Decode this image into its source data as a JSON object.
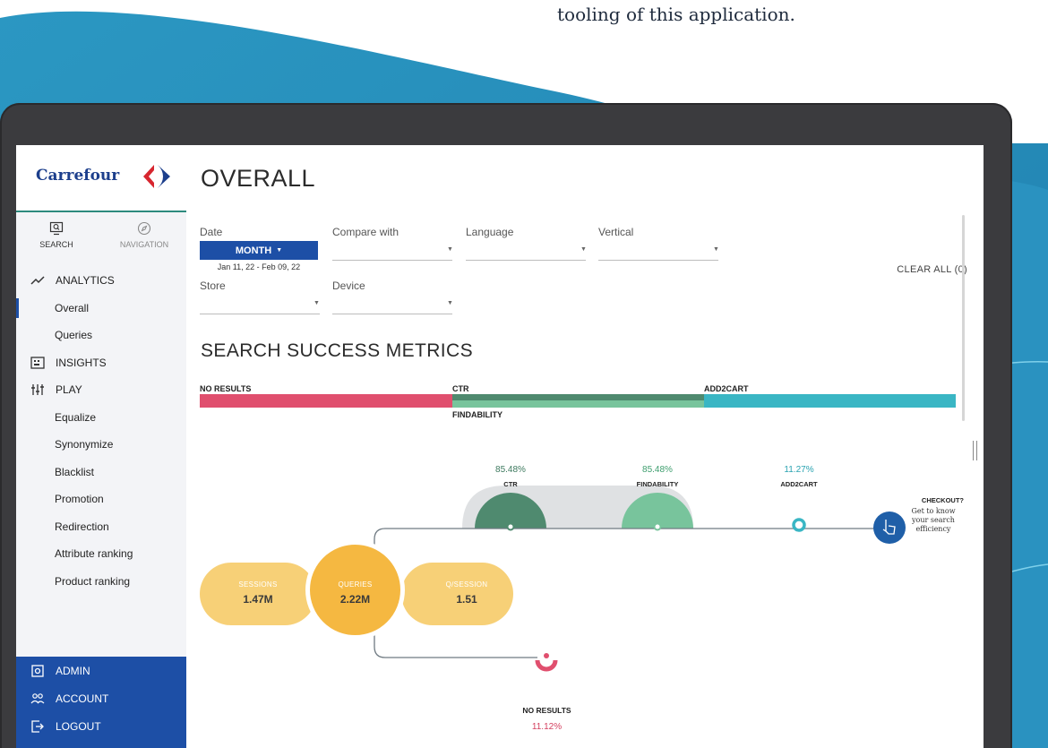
{
  "caption": "tooling of this application.",
  "colors": {
    "brand_blue": "#1d4fa6",
    "no_results": "#e04f6e",
    "ctr": "#4f8a6f",
    "findability": "#78c49c",
    "add2cart": "#3ab6c4",
    "sessions": "#f7d077",
    "queries": "#f5b841"
  },
  "brand": {
    "name": "Carrefour",
    "logo_icon": "carrefour-logo-icon"
  },
  "modes": [
    {
      "label": "SEARCH",
      "icon": "search-monitor-icon"
    },
    {
      "label": "NAVIGATION",
      "icon": "compass-icon"
    }
  ],
  "sidebar": {
    "items": [
      {
        "label": "ANALYTICS",
        "icon": "trend-icon",
        "type": "top"
      },
      {
        "label": "Overall",
        "type": "sub",
        "active": true
      },
      {
        "label": "Queries",
        "type": "sub"
      },
      {
        "label": "INSIGHTS",
        "icon": "insights-icon",
        "type": "top"
      },
      {
        "label": "PLAY",
        "icon": "sliders-icon",
        "type": "top"
      },
      {
        "label": "Equalize",
        "type": "sub"
      },
      {
        "label": "Synonymize",
        "type": "sub"
      },
      {
        "label": "Blacklist",
        "type": "sub"
      },
      {
        "label": "Promotion",
        "type": "sub"
      },
      {
        "label": "Redirection",
        "type": "sub"
      },
      {
        "label": "Attribute ranking",
        "type": "sub"
      },
      {
        "label": "Product ranking",
        "type": "sub"
      }
    ],
    "bottom": [
      {
        "label": "ADMIN",
        "icon": "gear-box-icon"
      },
      {
        "label": "ACCOUNT",
        "icon": "users-icon"
      },
      {
        "label": "LOGOUT",
        "icon": "logout-icon"
      }
    ]
  },
  "page": {
    "title": "OVERALL"
  },
  "filters": {
    "date_label": "Date",
    "month_button": "MONTH",
    "date_range": "Jan 11, 22 - Feb 09, 22",
    "compare_label": "Compare with",
    "language_label": "Language",
    "vertical_label": "Vertical",
    "store_label": "Store",
    "device_label": "Device",
    "clear_all": "CLEAR ALL (0)"
  },
  "metrics": {
    "title": "SEARCH SUCCESS METRICS",
    "bar_labels": {
      "no_results": "NO RESULTS",
      "ctr": "CTR",
      "findability": "FINDABILITY",
      "add2cart": "ADD2CART"
    }
  },
  "funnel": {
    "ctr": {
      "value": "85.48%",
      "label": "CTR"
    },
    "findability": {
      "value": "85.48%",
      "label": "FINDABILITY"
    },
    "add2cart": {
      "value": "11.27%",
      "label": "ADD2CART"
    },
    "checkout": {
      "title": "CHECKOUT?",
      "line1": "Get to know",
      "line2": "your search",
      "line3": "efficiency"
    },
    "sessions": {
      "label": "SESSIONS",
      "value": "1.47M"
    },
    "queries": {
      "label": "QUERIES",
      "value": "2.22M"
    },
    "q_session": {
      "label": "Q/SESSION",
      "value": "1.51"
    },
    "no_results": {
      "label": "NO RESULTS",
      "value": "11.12%"
    }
  }
}
